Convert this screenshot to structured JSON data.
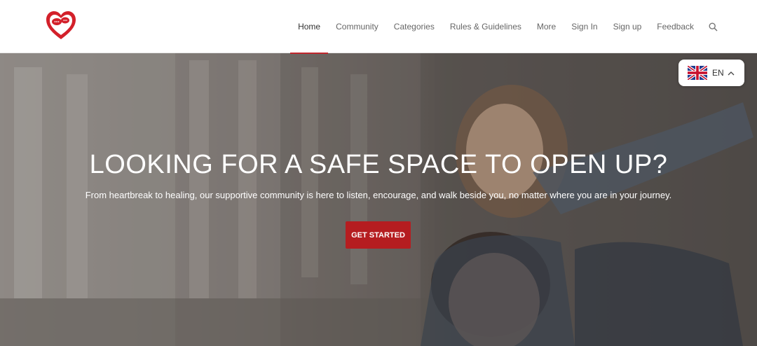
{
  "nav": {
    "items": [
      {
        "label": "Home",
        "active": true
      },
      {
        "label": "Community"
      },
      {
        "label": "Categories"
      },
      {
        "label": "Rules & Guidelines"
      },
      {
        "label": "More"
      },
      {
        "label": "Sign In"
      },
      {
        "label": "Sign up"
      },
      {
        "label": "Feedback"
      }
    ],
    "search_icon": "search-icon"
  },
  "language": {
    "code": "EN",
    "flag_icon": "uk-flag-icon",
    "caret_icon": "chevron-up-icon"
  },
  "hero": {
    "title": "LOOKING FOR A SAFE SPACE TO OPEN UP?",
    "subtitle": "From heartbreak to healing, our supportive community is here to listen, encourage, and walk beside you, no matter where you are in your journey.",
    "cta_label": "GET STARTED"
  },
  "colors": {
    "accent": "#c0272d",
    "cta": "#b51d20"
  }
}
